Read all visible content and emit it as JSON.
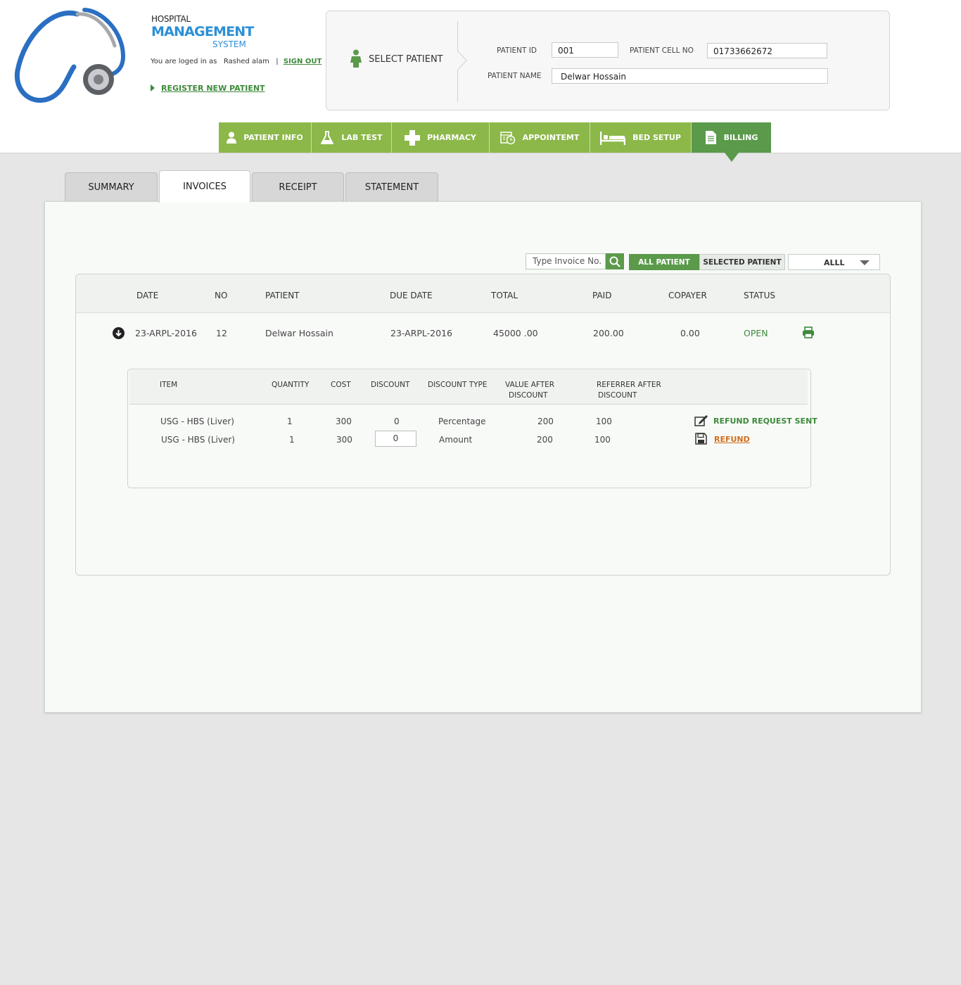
{
  "brand": {
    "line1": "HOSPITAL",
    "line2": "MANAGEMENT",
    "line3": "SYSTEM"
  },
  "session": {
    "logged_in_text": "You are loged in as",
    "user": "Rashed alam",
    "separator": "|",
    "sign_out": "SIGN OUT"
  },
  "register_link": "REGISTER NEW PATIENT",
  "patient_select": {
    "label": "SELECT PATIENT",
    "id_label": "PATIENT ID",
    "id_value": "001",
    "cell_label": "PATIENT CELL NO",
    "cell_value": "01733662672",
    "name_label": "PATIENT NAME",
    "name_value": "Delwar Hossain"
  },
  "nav": [
    {
      "label": "PATIENT INFO",
      "icon": "person-icon"
    },
    {
      "label": "LAB TEST",
      "icon": "flask-icon"
    },
    {
      "label": "PHARMACY",
      "icon": "cross-icon"
    },
    {
      "label": "APPOINTEMT",
      "icon": "calendar-clock-icon"
    },
    {
      "label": "BED SETUP",
      "icon": "bed-icon"
    },
    {
      "label": "BILLING",
      "icon": "document-icon",
      "active": true
    }
  ],
  "tabs": [
    {
      "label": "SUMMARY"
    },
    {
      "label": "INVOICES",
      "active": true
    },
    {
      "label": "RECEIPT"
    },
    {
      "label": "STATEMENT"
    }
  ],
  "filters": {
    "search_placeholder": "Type Invoice No.",
    "all_patient": "ALL PATIENT",
    "selected_patient": "SELECTED PATIENT",
    "dropdown_value": "ALLL"
  },
  "invoice_columns": [
    "DATE",
    "NO",
    "PATIENT",
    "DUE DATE",
    "TOTAL",
    "PAID",
    "COPAYER",
    "STATUS"
  ],
  "invoice_row": {
    "date": "23-ARPL-2016",
    "no": "12",
    "patient": "Delwar Hossain",
    "due_date": "23-ARPL-2016",
    "total": "45000 .00",
    "paid": "200.00",
    "copayer": "0.00",
    "status": "OPEN"
  },
  "item_columns": {
    "item": "ITEM",
    "quantity": "QUANTITY",
    "cost": "COST",
    "discount": "DISCOUNT",
    "discount_type": "DISCOUNT TYPE",
    "value_after_1": "VALUE AFTER",
    "value_after_2": "DISCOUNT",
    "referrer_after_1": "REFERRER AFTER",
    "referrer_after_2": "DISCOUNT"
  },
  "items": [
    {
      "item": "USG - HBS (Liver)",
      "quantity": "1",
      "cost": "300",
      "discount": "0",
      "discount_type": "Percentage",
      "value_after": "200",
      "referrer_after": "100",
      "action": "REFUND REQUEST SENT"
    },
    {
      "item": "USG - HBS (Liver)",
      "quantity": "1",
      "cost": "300",
      "discount": "0",
      "discount_type": "Amount",
      "value_after": "200",
      "referrer_after": "100",
      "action": "REFUND"
    }
  ],
  "colors": {
    "nav_green": "#8bb849",
    "active_green": "#5a9a4a",
    "text_green": "#3d8a3a",
    "brand_blue": "#2c8fd6",
    "refund_orange": "#d06f1d"
  }
}
